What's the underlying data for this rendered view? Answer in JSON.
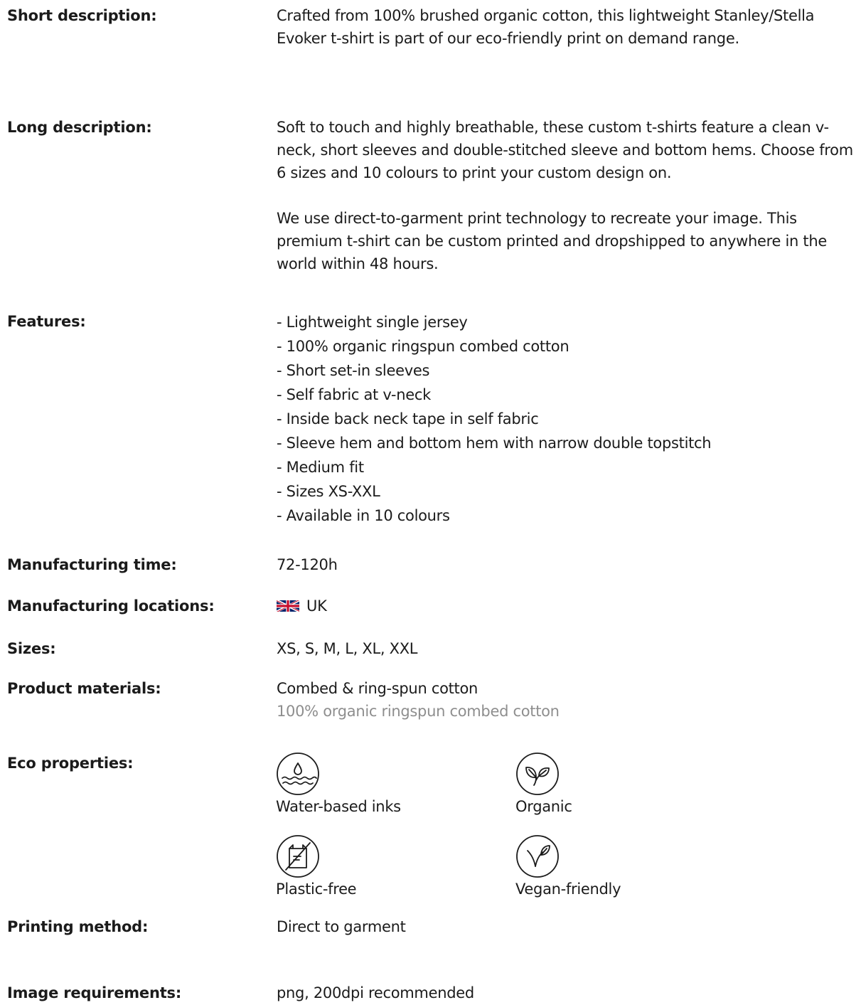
{
  "rows": {
    "short_description": {
      "label": "Short description:",
      "value": "Crafted from 100% brushed organic cotton, this lightweight Stanley/Stella Evoker t-shirt is part of our eco-friendly print on demand range."
    },
    "long_description": {
      "label": "Long description:",
      "paragraphs": [
        "Soft to touch and highly breathable, these custom t-shirts feature a clean v-neck, short sleeves and double-stitched sleeve and bottom hems. Choose from 6 sizes and 10 colours to print your custom design on.",
        "We use direct-to-garment print technology to recreate your image. This premium t-shirt can be custom printed and dropshipped to anywhere in the world within 48 hours."
      ]
    },
    "features": {
      "label": "Features:",
      "items": [
        "- Lightweight single jersey",
        "- 100% organic ringspun combed cotton",
        "- Short set-in sleeves",
        "- Self fabric at v-neck",
        "- Inside back neck tape in self fabric",
        "- Sleeve hem and bottom hem with narrow double topstitch",
        "- Medium fit",
        "- Sizes XS-XXL",
        "- Available in 10 colours"
      ]
    },
    "manufacturing_time": {
      "label": "Manufacturing time:",
      "value": "72-120h"
    },
    "manufacturing_locations": {
      "label": "Manufacturing locations:",
      "value": "UK",
      "flag_icon": "uk-flag-icon"
    },
    "sizes": {
      "label": "Sizes:",
      "value": "XS, S, M, L, XL, XXL"
    },
    "product_materials": {
      "label": "Product materials:",
      "value": "Combed & ring-spun cotton",
      "detail": "100% organic ringspun combed cotton"
    },
    "eco_properties": {
      "label": "Eco properties:",
      "items": [
        {
          "icon": "water-drop-icon",
          "label": "Water-based inks"
        },
        {
          "icon": "leaves-icon",
          "label": "Organic"
        },
        {
          "icon": "no-plastic-bag-icon",
          "label": "Plastic-free"
        },
        {
          "icon": "sprout-icon",
          "label": "Vegan-friendly"
        }
      ]
    },
    "printing_method": {
      "label": "Printing method:",
      "value": "Direct to garment"
    },
    "image_requirements": {
      "label": "Image requirements:",
      "value": "png, 200dpi recommended"
    }
  },
  "colors": {
    "text": "#1b1b1b",
    "muted": "#8e8e8e",
    "background": "#ffffff"
  }
}
